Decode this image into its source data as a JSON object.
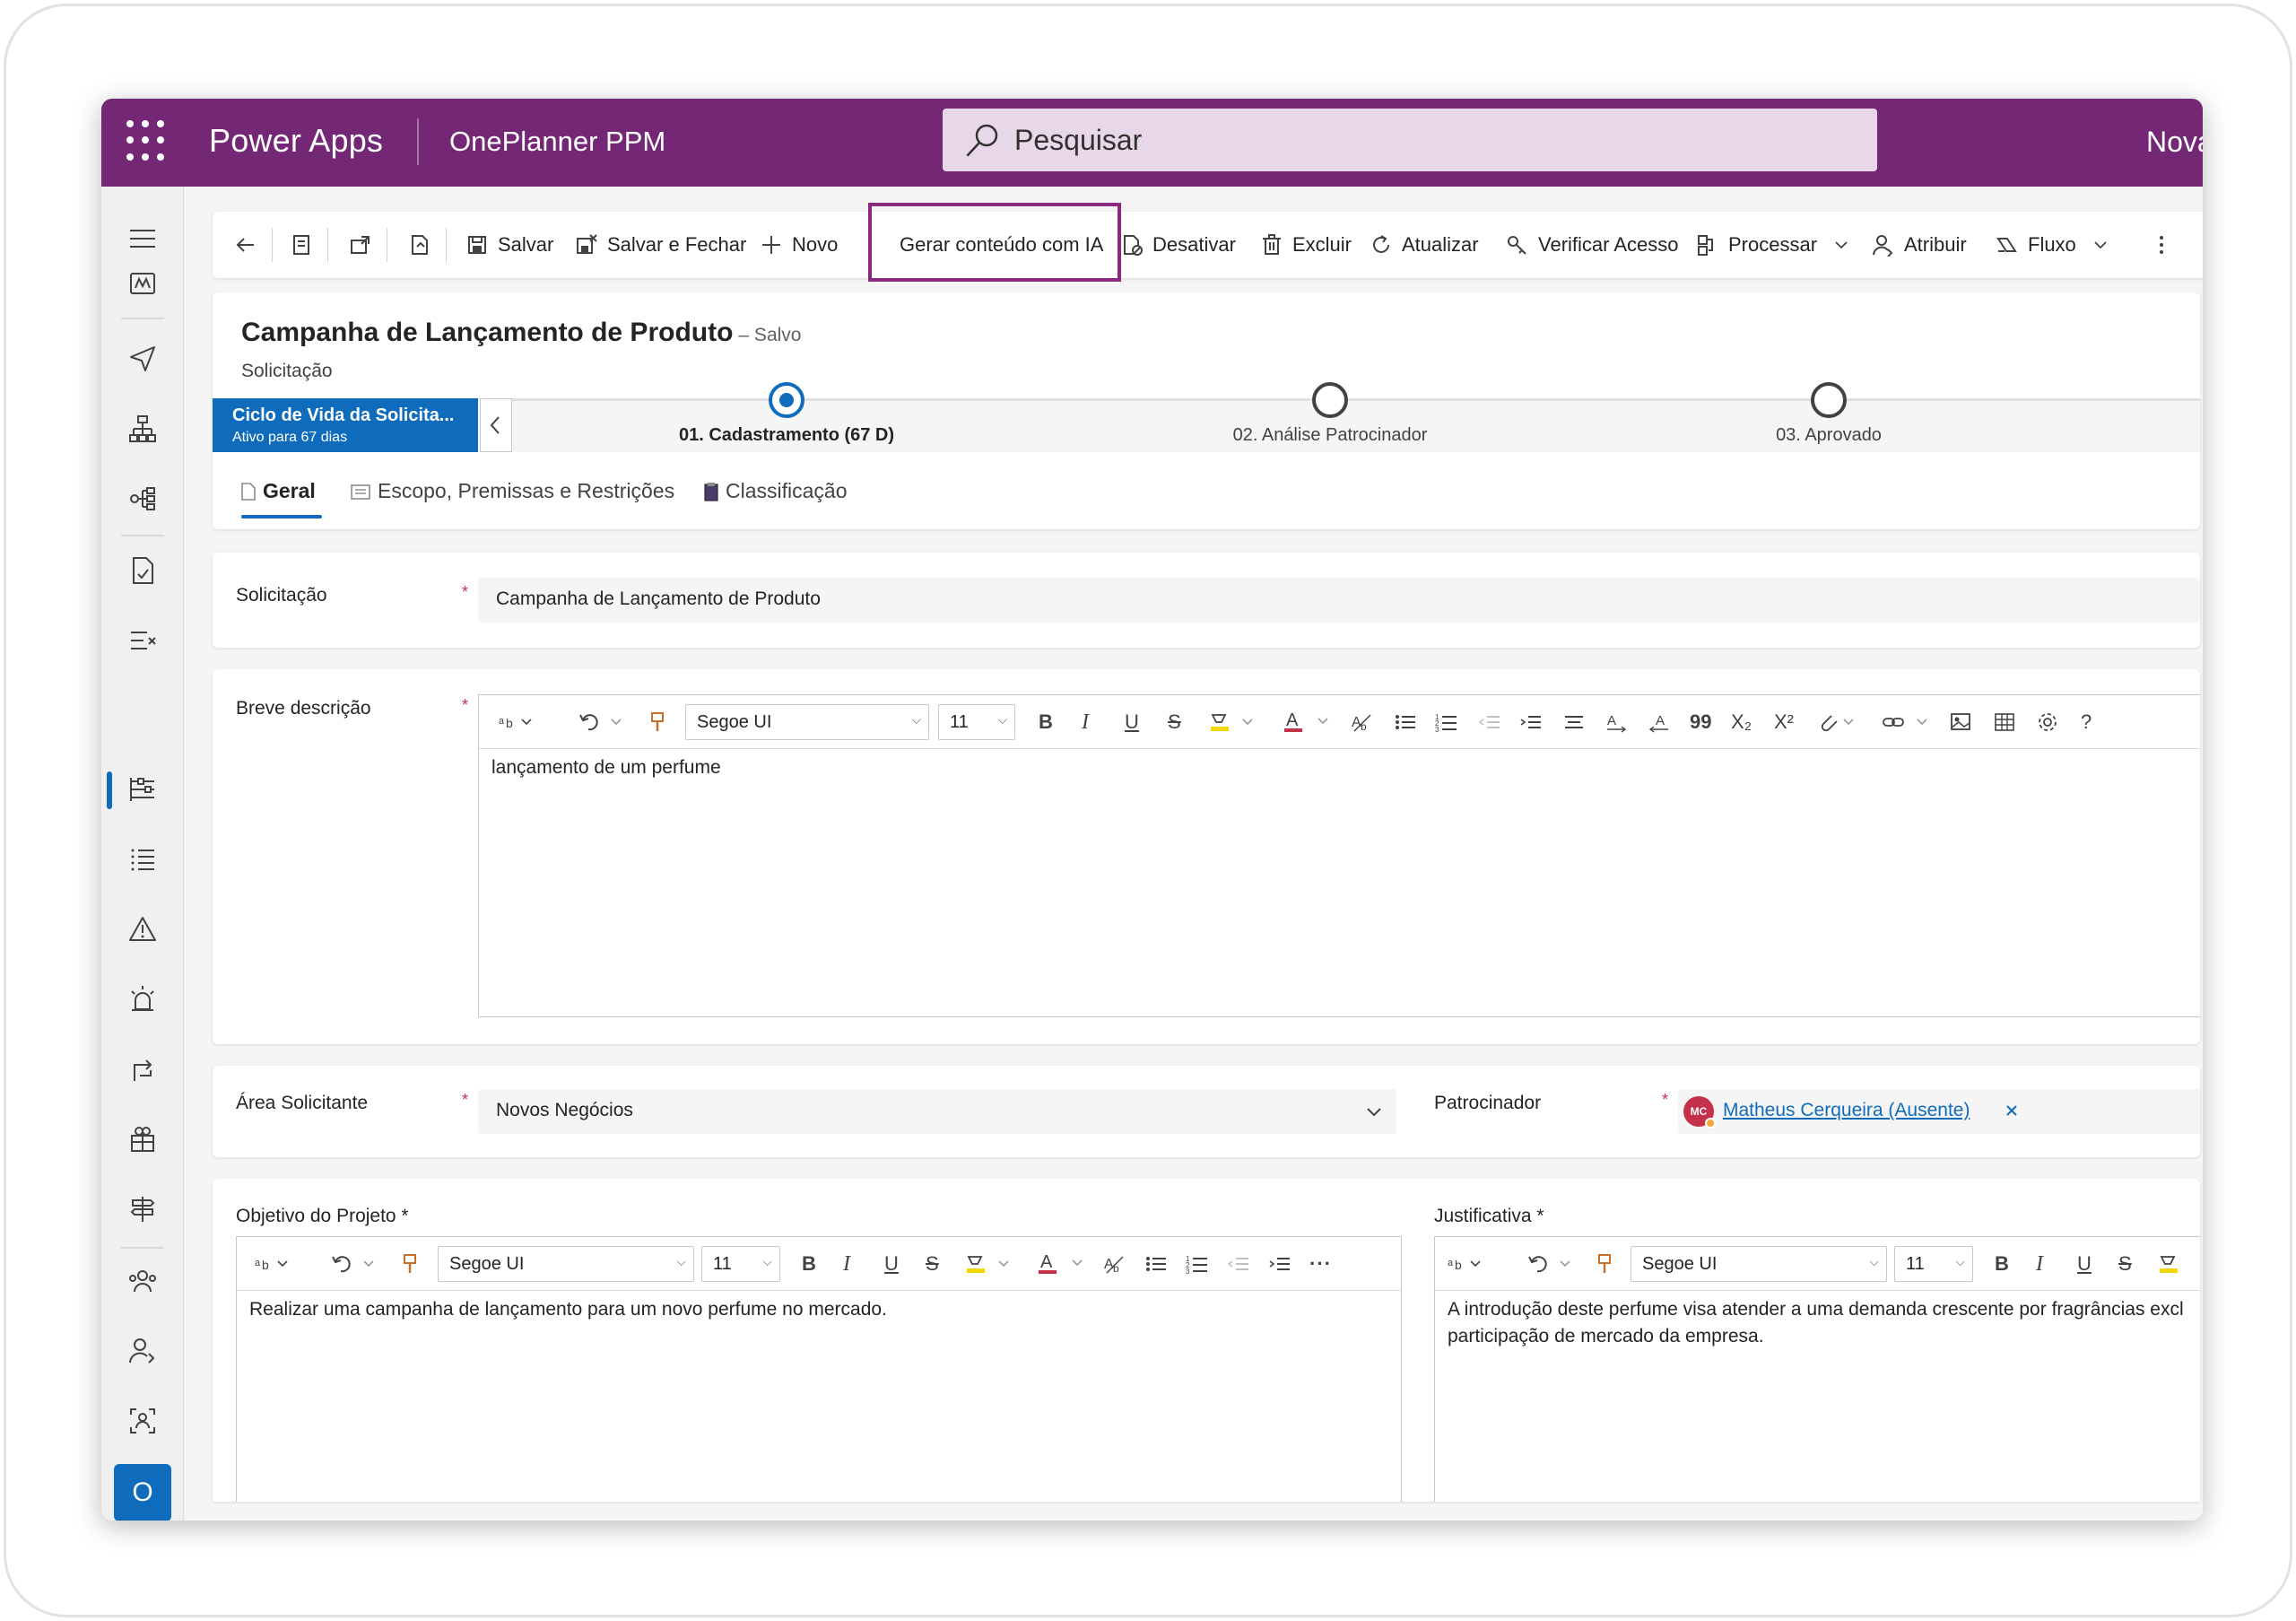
{
  "topbar": {
    "app_name": "Power Apps",
    "environment": "OnePlanner PPM",
    "search_placeholder": "Pesquisar",
    "right_text": "Nova"
  },
  "left_nav": {
    "avatar_initial": "O",
    "active_item": "sections-icon"
  },
  "command_bar": {
    "save": "Salvar",
    "save_close": "Salvar e Fechar",
    "new": "Novo",
    "generate_ai": "Gerar conteúdo com IA",
    "deactivate": "Desativar",
    "delete": "Excluir",
    "refresh": "Atualizar",
    "check_access": "Verificar Acesso",
    "process": "Processar",
    "assign": "Atribuir",
    "flow": "Fluxo"
  },
  "header": {
    "title": "Campanha de Lançamento de Produto",
    "status": "– Salvo",
    "entity": "Solicitação"
  },
  "process_flow": {
    "active_stage_title": "Ciclo de Vida da Solicita...",
    "active_stage_sub": "Ativo para 67 dias",
    "stages": [
      {
        "label": "01. Cadastramento  (67 D)",
        "active": true
      },
      {
        "label": "02. Análise Patrocinador",
        "active": false
      },
      {
        "label": "03. Aprovado",
        "active": false
      }
    ]
  },
  "tabs": [
    {
      "label": "Geral",
      "active": true
    },
    {
      "label": "Escopo, Premissas e Restrições",
      "active": false
    },
    {
      "label": "Classificação",
      "active": false
    }
  ],
  "fields": {
    "solicitacao_label": "Solicitação",
    "solicitacao_value": "Campanha de Lançamento de Produto",
    "breve_label": "Breve descrição",
    "breve_value": "lançamento de um perfume",
    "area_label": "Área Solicitante",
    "area_value": "Novos Negócios",
    "patrocinador_label": "Patrocinador",
    "patrocinador_initials": "MC",
    "patrocinador_value": "Matheus Cerqueira (Ausente)",
    "objetivo_label": "Objetivo do Projeto *",
    "objetivo_value": "Realizar uma campanha de lançamento para um novo perfume no mercado.",
    "justificativa_label": "Justificativa *",
    "justificativa_value_1": "A introdução deste perfume visa atender a uma demanda crescente por fragrâncias excl",
    "justificativa_value_2": "participação de mercado da empresa.",
    "required_mark": "*"
  },
  "editor": {
    "font": "Segoe UI",
    "size": "11",
    "bold": "B",
    "italic": "I",
    "underline": "U",
    "strike": "S",
    "font_color": "A",
    "help": "?",
    "more": "···",
    "subscript": "X₂",
    "superscript": "X²",
    "quote": "99"
  },
  "colors": {
    "brand": "#742774",
    "accent": "#0f6cbd",
    "highlight_border": "#8a2a7e"
  }
}
